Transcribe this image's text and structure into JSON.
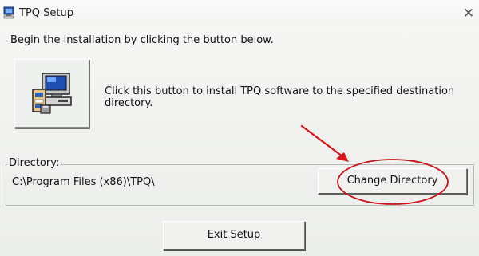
{
  "window": {
    "title": "TPQ Setup",
    "close_glyph": "✕"
  },
  "intro": {
    "text": "Begin the installation by clicking the button below."
  },
  "install": {
    "icon": "computer-setup-icon",
    "description": "Click this button to install TPQ software to the specified destination directory."
  },
  "directory": {
    "legend": "Directory:",
    "path": "C:\\Program Files (x86)\\TPQ\\",
    "change_button_label": "Change Directory"
  },
  "footer": {
    "exit_button_label": "Exit Setup"
  },
  "colors": {
    "window_bg": "#f0f1ef",
    "annotation": "#d9141b",
    "group_border": "#b5b7b4"
  }
}
